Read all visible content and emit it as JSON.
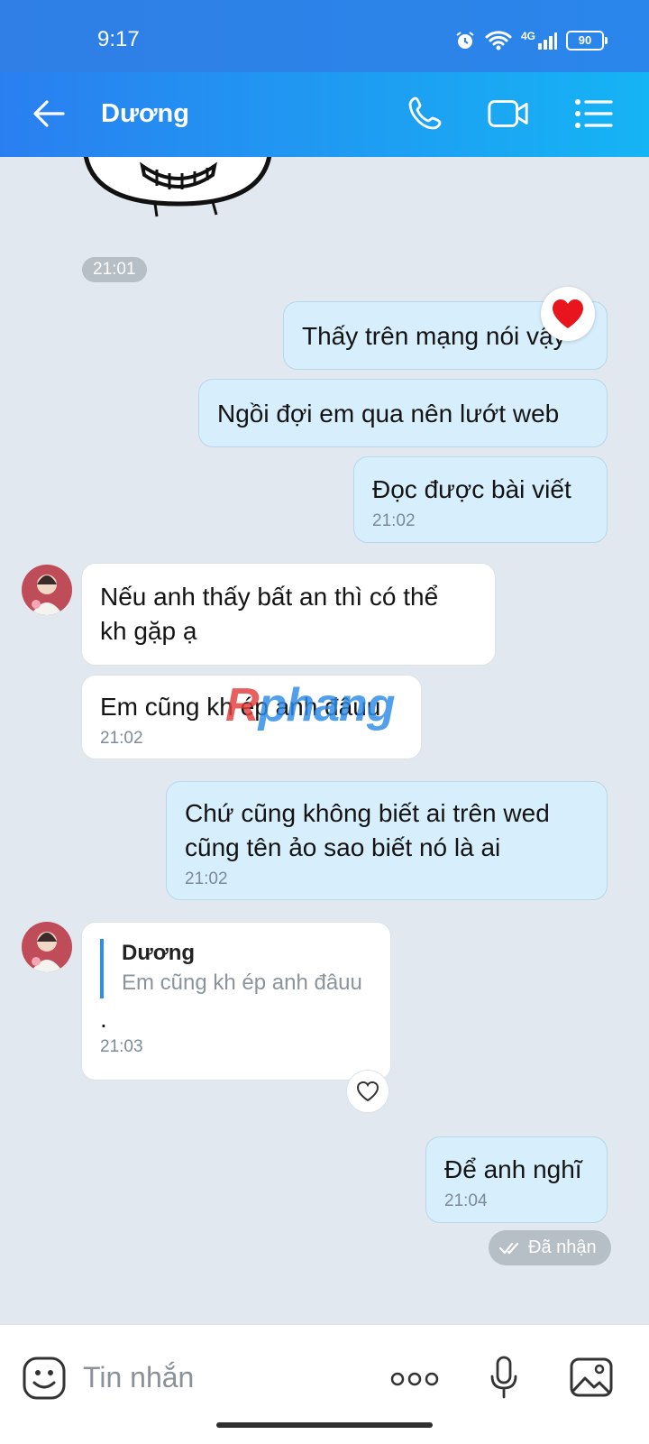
{
  "status_bar": {
    "time": "9:17",
    "network": "4G",
    "battery": "90"
  },
  "header": {
    "title": "Dương"
  },
  "messages": [
    {
      "time": "21:01"
    },
    {
      "text": "Thấy trên mạng nói vậy"
    },
    {
      "text": "Ngồi đợi em qua nên lướt web"
    },
    {
      "text": "Đọc được bài viết",
      "time": "21:02"
    },
    {
      "text_line1": "Nếu anh thấy bất an thì có thể",
      "text_line2": "kh gặp ạ"
    },
    {
      "text": "Em cũng kh ép anh đâuu",
      "time": "21:02"
    },
    {
      "text_line1": "Chứ cũng không biết ai trên wed",
      "text_line2": "cũng tên ảo sao biết nó là ai",
      "time": "21:02"
    },
    {
      "quote_name": "Dương",
      "quote_text": "Em cũng kh ép anh đâuu",
      "text": ".",
      "time": "21:03"
    },
    {
      "text": "Để anh nghĩ",
      "time": "21:04"
    }
  ],
  "delivery_status": "Đã nhận",
  "watermark": {
    "part1": "R",
    "part2": "phang"
  },
  "input": {
    "placeholder": "Tin nhắn"
  },
  "colors": {
    "header_start": "#2a7ff0",
    "header_end": "#15b4f4",
    "outgoing_bubble": "#d7eefc",
    "incoming_bubble": "#ffffff",
    "chat_bg": "#e2e8ef"
  }
}
